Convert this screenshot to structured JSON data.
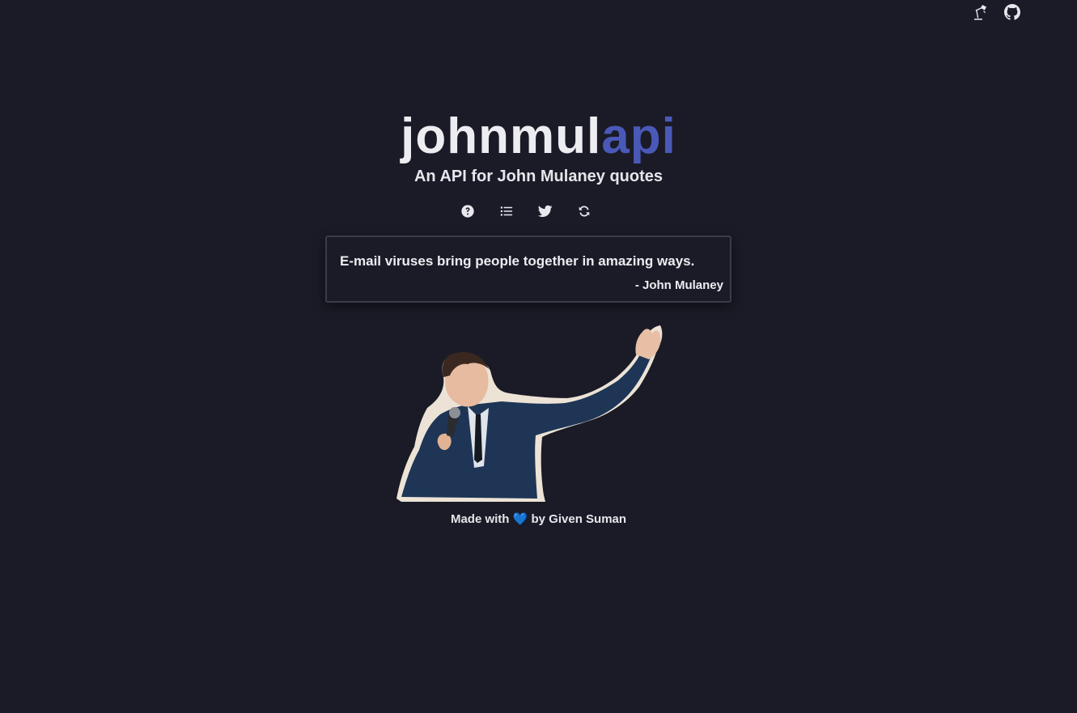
{
  "header": {
    "icons": [
      "lamp-icon",
      "github-icon"
    ]
  },
  "hero": {
    "title_part1": "johnmul",
    "title_part2": "api",
    "subtitle": "An API for John Mulaney quotes",
    "accent_color": "#4a59b8",
    "background_color": "#1a1b26"
  },
  "nav": {
    "icons": [
      "help-icon",
      "list-icon",
      "twitter-icon",
      "refresh-icon"
    ]
  },
  "quote": {
    "text": "E-mail viruses bring people together in amazing ways.",
    "author": "- John Mulaney"
  },
  "footer": {
    "prefix": "Made with",
    "heart": "💙",
    "suffix": "by Given Suman"
  }
}
